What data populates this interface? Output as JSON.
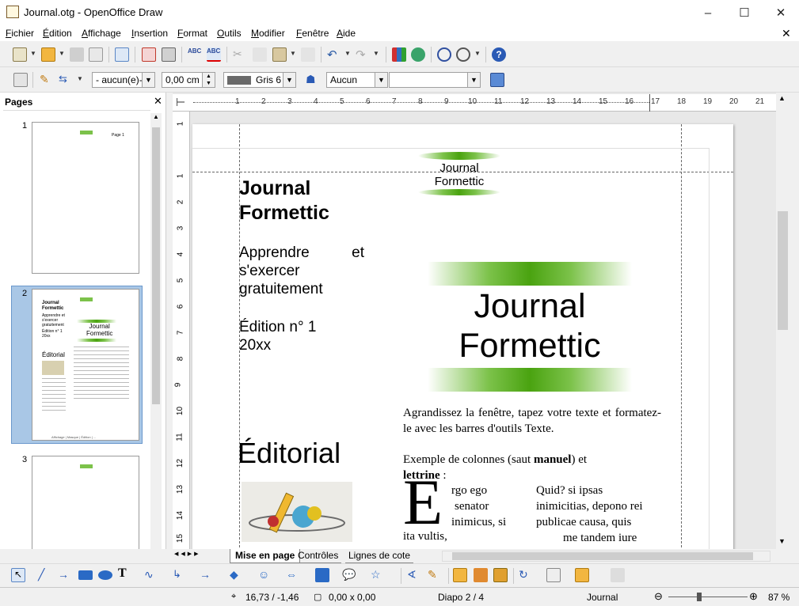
{
  "window": {
    "title": "Journal.otg - OpenOffice Draw"
  },
  "menu": [
    "Fichier",
    "Édition",
    "Affichage",
    "Insertion",
    "Format",
    "Outils",
    "Modifier",
    "Fenêtre",
    "Aide"
  ],
  "toolbar2": {
    "line_style": "- aucun(e)-",
    "line_width": "0,00 cm",
    "line_color": "Gris 6",
    "area_style": "Aucun",
    "area_value": ""
  },
  "pages_panel": {
    "title": "Pages",
    "page_numbers": [
      "1",
      "2",
      "3"
    ],
    "thumb1": {
      "header": "Page 1"
    },
    "thumb2": {
      "t1": "Journal",
      "t2": "Formettic",
      "t3": "Apprendre et",
      "t4": "s'exercer",
      "t5": "gratuitement",
      "t6": "Édition n° 1",
      "t7": "20xx",
      "t8": "Éditorial",
      "t9": "Journal",
      "t10": "Formettic",
      "footer": "Affichage | Masque | Édition | ..."
    }
  },
  "ruler_numbers": [
    "1",
    "2",
    "3",
    "4",
    "5",
    "6",
    "7",
    "8",
    "9",
    "10",
    "11",
    "12",
    "13",
    "14",
    "15",
    "16",
    "17",
    "18",
    "19",
    "20",
    "21"
  ],
  "vruler_numbers": [
    "1",
    "1",
    "2",
    "3",
    "4",
    "5",
    "6",
    "7",
    "8",
    "9",
    "10",
    "11",
    "12",
    "13",
    "14",
    "15"
  ],
  "document": {
    "logo_line1": "Journal",
    "logo_line2": "Formettic",
    "left_title_1": "Journal",
    "left_title_2": "Formettic",
    "subtitle_1": "Apprendre",
    "subtitle_1b": "et",
    "subtitle_2": "s'exercer",
    "subtitle_3": "gratuitement",
    "edition_1": "Édition n° 1",
    "edition_2": "20xx",
    "editorial": "Éditorial",
    "big_title_1": "Journal",
    "big_title_2": "Formettic",
    "para1": "Agrandissez la fenêtre, tapez votre texte et formatez-le avec les barres d'outils Texte.",
    "para2_a": "Exemple de colonnes (saut ",
    "para2_b": "manuel",
    "para2_c": ") et",
    "para2_d": "lettrine",
    "para2_e": " :",
    "dropcap": "E",
    "col1": [
      "rgo ego",
      "senator",
      "inimicus, si"
    ],
    "col1_last": "ita vultis,",
    "col2": [
      "Quid? si ipsas",
      "inimicitias, depono rei",
      "publicae causa, quis"
    ],
    "col2_last": "me tandem iure"
  },
  "tabs": [
    "Mise en page",
    "Contrôles",
    "Lignes de cote"
  ],
  "status": {
    "position": "16,73 / -1,46",
    "size": "0,00 x 0,00",
    "slide": "Diapo 2 / 4",
    "master": "Journal",
    "zoom": "87 %"
  },
  "colors": {
    "accent_green": "#4aa310",
    "selected_page": "#a9c7e6"
  }
}
